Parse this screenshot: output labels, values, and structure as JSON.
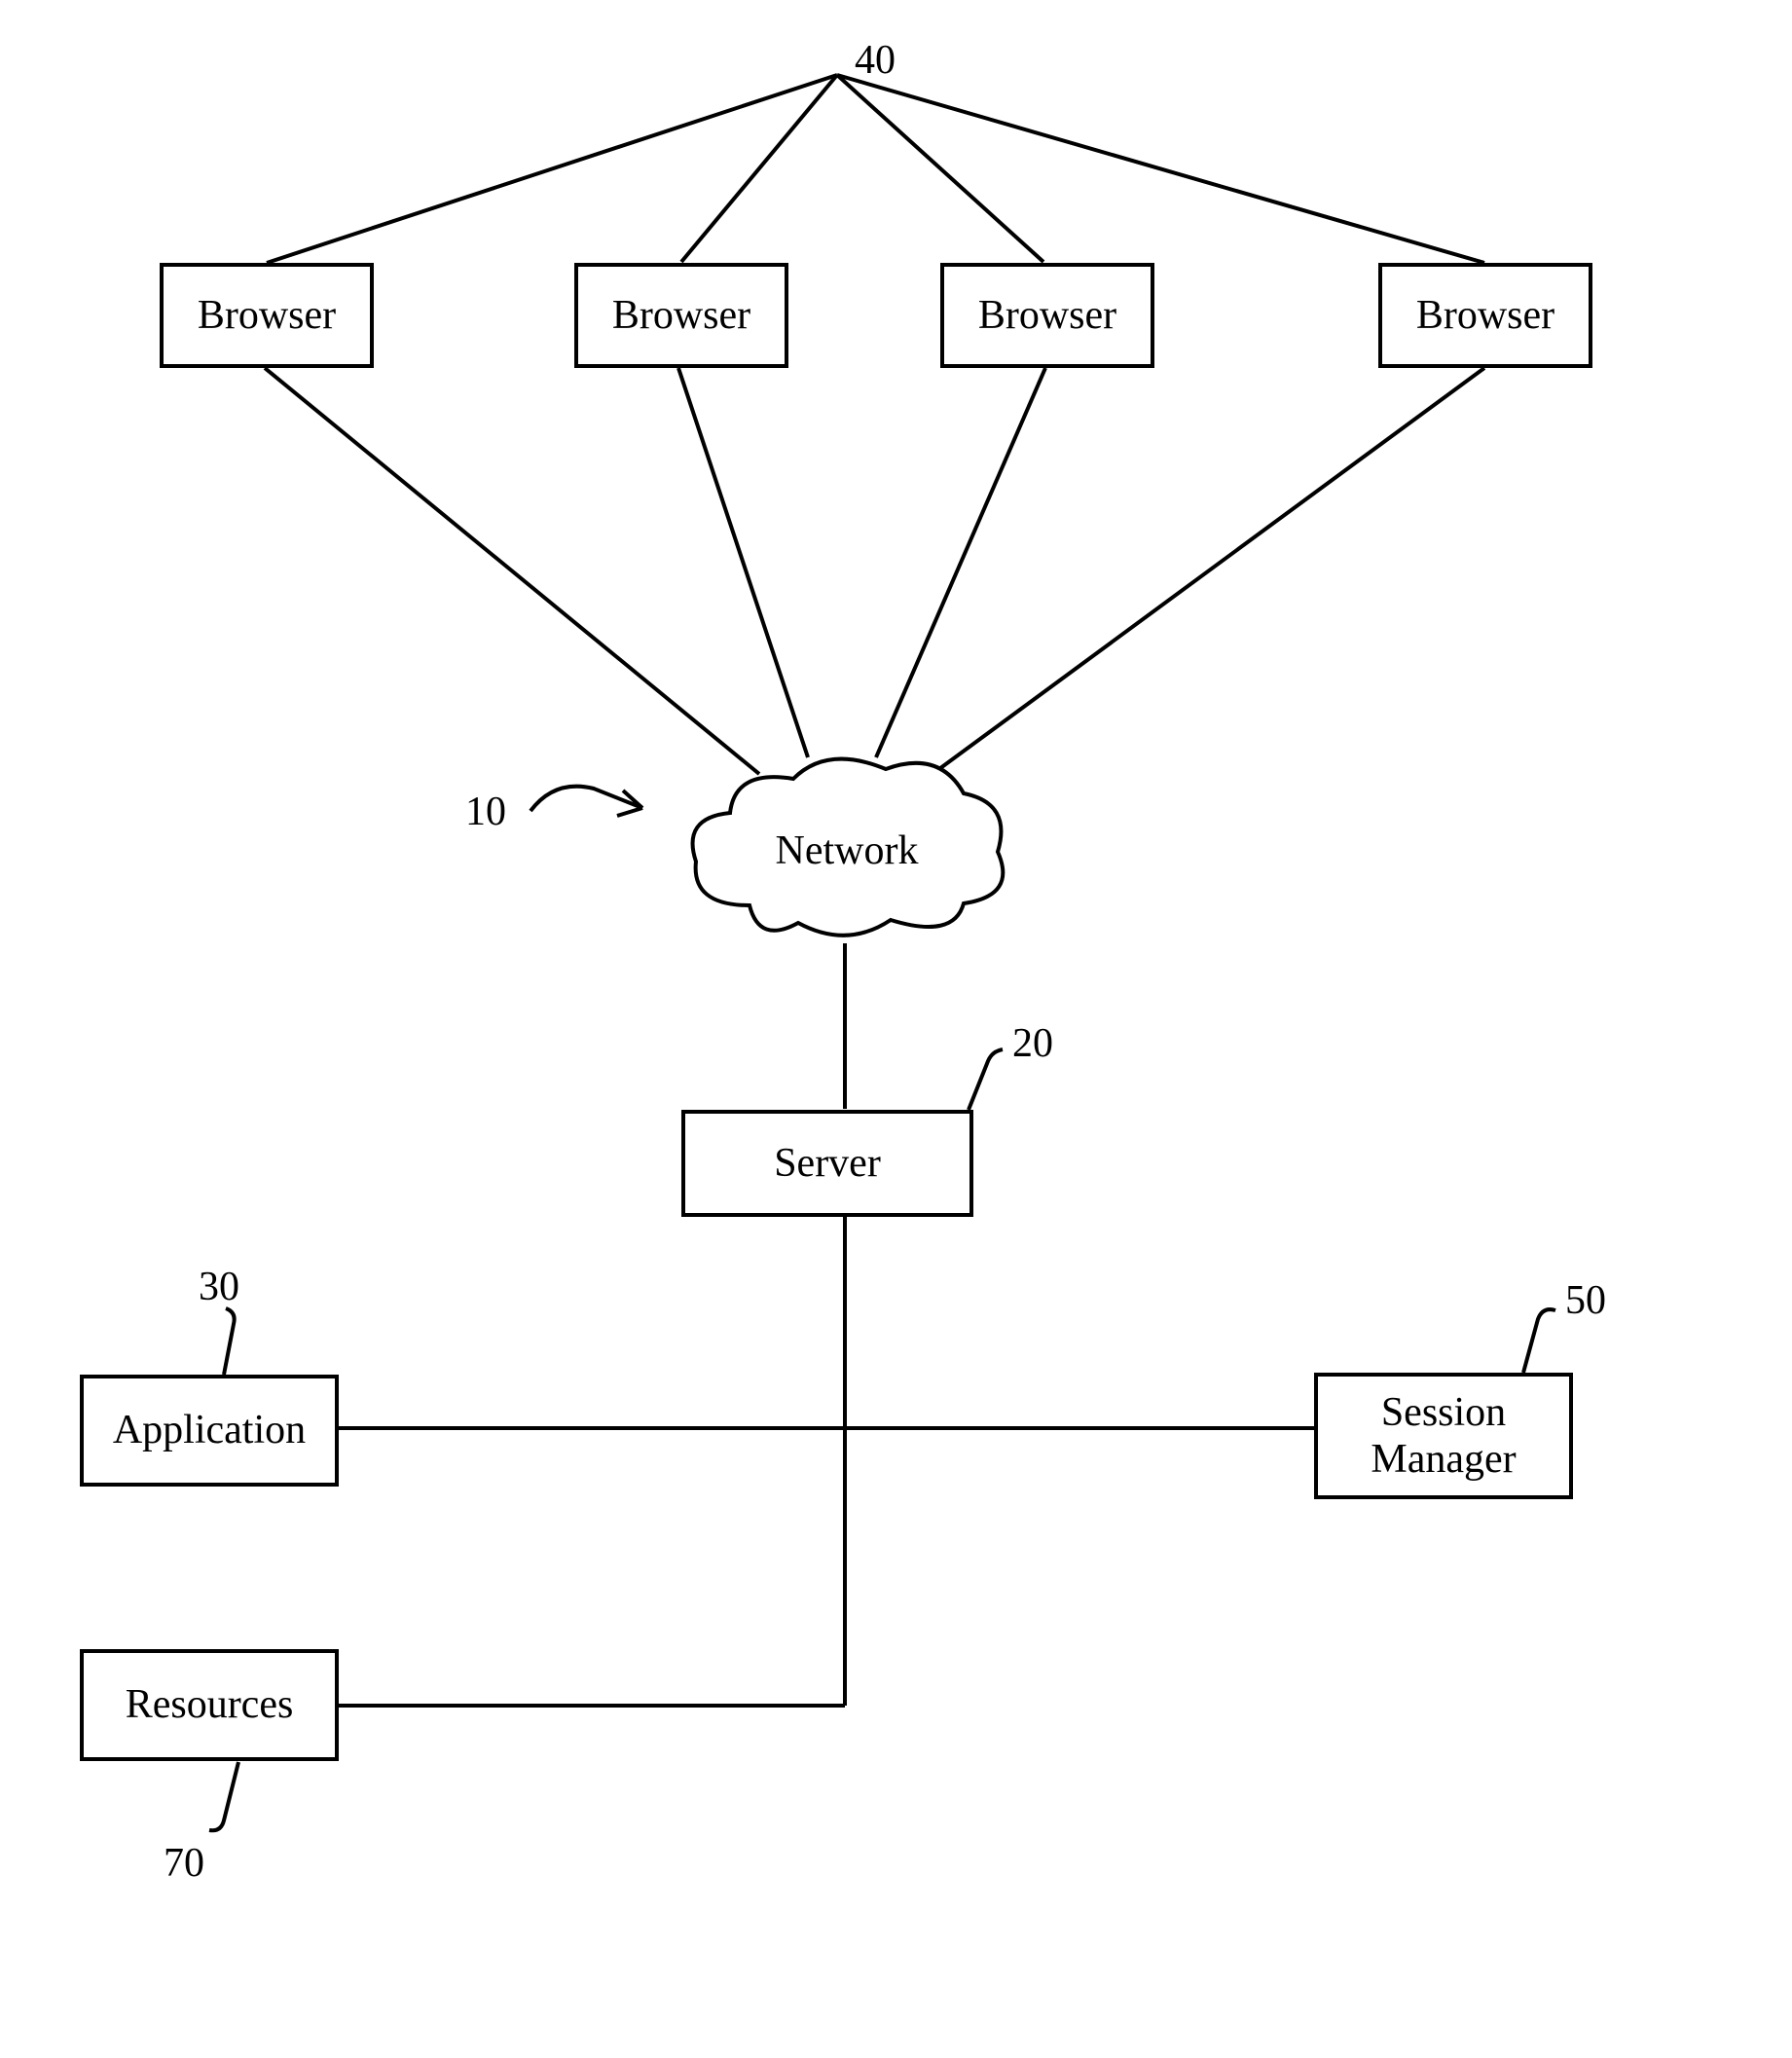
{
  "refs": {
    "browsers_group": "40",
    "system": "10",
    "server": "20",
    "application": "30",
    "session_manager": "50",
    "resources": "70"
  },
  "nodes": {
    "browser1": "Browser",
    "browser2": "Browser",
    "browser3": "Browser",
    "browser4": "Browser",
    "network": "Network",
    "server": "Server",
    "application": "Application",
    "session_manager": "Session\nManager",
    "resources": "Resources"
  }
}
